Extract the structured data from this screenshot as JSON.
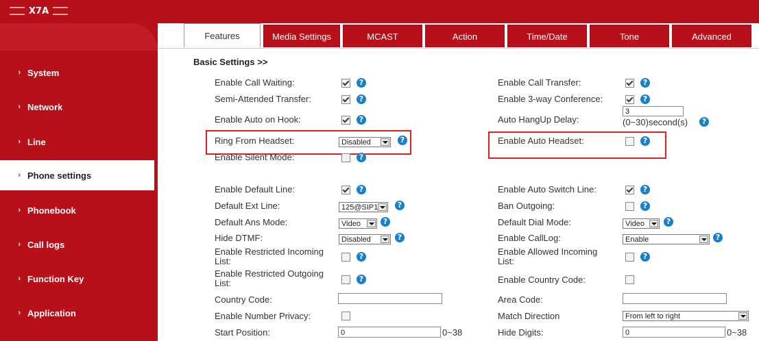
{
  "header": {
    "logo": "X7A"
  },
  "sidebar": {
    "items": [
      {
        "label": "System"
      },
      {
        "label": "Network"
      },
      {
        "label": "Line"
      },
      {
        "label": "Phone settings"
      },
      {
        "label": "Phonebook"
      },
      {
        "label": "Call logs"
      },
      {
        "label": "Function Key"
      },
      {
        "label": "Application"
      }
    ],
    "active": "Phone settings"
  },
  "tabs": [
    "Features",
    "Media Settings",
    "MCAST",
    "Action",
    "Time/Date",
    "Tone",
    "Advanced"
  ],
  "active_tab": "Features",
  "section_title": "Basic Settings >>",
  "left": {
    "call_waiting": {
      "label": "Enable Call Waiting:",
      "checked": true
    },
    "semi_transfer": {
      "label": "Semi-Attended Transfer:",
      "checked": true
    },
    "auto_on_hook": {
      "label": "Enable Auto on Hook:",
      "checked": true
    },
    "ring_headset": {
      "label": "Ring From Headset:",
      "value": "Disabled"
    },
    "silent_mode": {
      "label": "Enable Silent Mode:",
      "checked": false
    },
    "default_line": {
      "label": "Enable Default Line:",
      "checked": true
    },
    "default_ext": {
      "label": "Default Ext Line:",
      "value": "125@SIP1"
    },
    "default_ans": {
      "label": "Default Ans Mode:",
      "value": "Video"
    },
    "hide_dtmf": {
      "label": "Hide DTMF:",
      "value": "Disabled"
    },
    "restricted_in": {
      "label_line1": "Enable Restricted Incoming",
      "label_line2": "List:",
      "checked": false
    },
    "restricted_out": {
      "label_line1": "Enable Restricted Outgoing",
      "label_line2": "List:",
      "checked": false
    },
    "country_code": {
      "label": "Country Code:",
      "value": ""
    },
    "number_privacy": {
      "label": "Enable Number Privacy:",
      "checked": false
    },
    "start_position": {
      "label": "Start Position:",
      "value": "0",
      "range": "0~38"
    }
  },
  "right": {
    "call_transfer": {
      "label": "Enable Call Transfer:",
      "checked": true
    },
    "three_way": {
      "label": "Enable 3-way Conference:",
      "checked": true
    },
    "hangup_delay": {
      "label": "Auto HangUp Delay:",
      "value": "3",
      "range": "(0~30)second(s)"
    },
    "auto_headset": {
      "label": "Enable Auto Headset:",
      "checked": false
    },
    "auto_switch": {
      "label": "Enable Auto Switch Line:",
      "checked": true
    },
    "ban_outgoing": {
      "label": "Ban Outgoing:",
      "checked": false
    },
    "dial_mode": {
      "label": "Default Dial Mode:",
      "value": "Video"
    },
    "calllog": {
      "label": "Enable CallLog:",
      "value": "Enable"
    },
    "allowed_in": {
      "label_line1": "Enable Allowed Incoming",
      "label_line2": "List:",
      "checked": false
    },
    "country_code_en": {
      "label": "Enable Country Code:",
      "checked": false
    },
    "area_code": {
      "label": "Area Code:",
      "value": ""
    },
    "match_dir": {
      "label": "Match Direction",
      "value": "From left to right"
    },
    "hide_digits": {
      "label": "Hide Digits:",
      "value": "0",
      "range": "0~38"
    }
  },
  "help_glyph": "?",
  "chevron_glyph": "›",
  "colors": {
    "brand": "#b8101a",
    "help": "#1a7fc9",
    "highlight": "#e02020"
  }
}
